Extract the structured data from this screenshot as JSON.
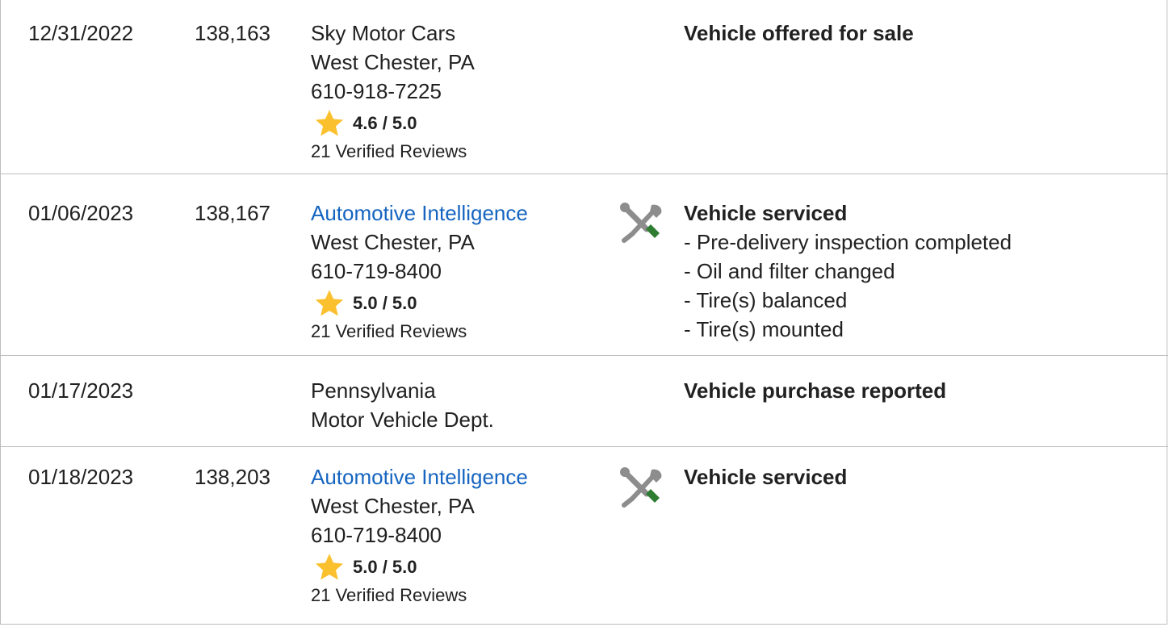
{
  "records": [
    {
      "date": "12/31/2022",
      "odometer": "138,163",
      "source": {
        "name": "Sky Motor Cars",
        "is_link": false,
        "city": "West Chester, PA",
        "phone": "610-918-7225",
        "rating": "4.6 / 5.0",
        "reviews": "21 Verified Reviews"
      },
      "service_icon": null,
      "title": "Vehicle offered for sale",
      "details": []
    },
    {
      "date": "01/06/2023",
      "odometer": "138,167",
      "source": {
        "name": "Automotive Intelligence",
        "is_link": true,
        "city": "West Chester, PA",
        "phone": "610-719-8400",
        "rating": "5.0 / 5.0",
        "reviews": "21 Verified Reviews"
      },
      "service_icon": "wrench-screwdriver-icon",
      "title": "Vehicle serviced",
      "details": [
        "- Pre-delivery inspection completed",
        "- Oil and filter changed",
        "- Tire(s) balanced",
        "- Tire(s) mounted"
      ]
    },
    {
      "date": "01/17/2023",
      "odometer": "",
      "source": {
        "name": "Pennsylvania",
        "name_line2": "Motor Vehicle Dept."
      },
      "service_icon": null,
      "title": "Vehicle purchase reported",
      "details": []
    },
    {
      "date": "01/18/2023",
      "odometer": "138,203",
      "source": {
        "name": "Automotive Intelligence",
        "is_link": true,
        "city": "West Chester, PA",
        "phone": "610-719-8400",
        "rating": "5.0 / 5.0",
        "reviews": "21 Verified Reviews"
      },
      "service_icon": "wrench-screwdriver-icon",
      "title": "Vehicle serviced",
      "details": []
    }
  ],
  "colors": {
    "link": "#1565c0",
    "star": "#fbc02d",
    "screwdriver_handle": "#2e7d32",
    "wrench": "#8d8d8d",
    "border": "#bdbdbd"
  }
}
